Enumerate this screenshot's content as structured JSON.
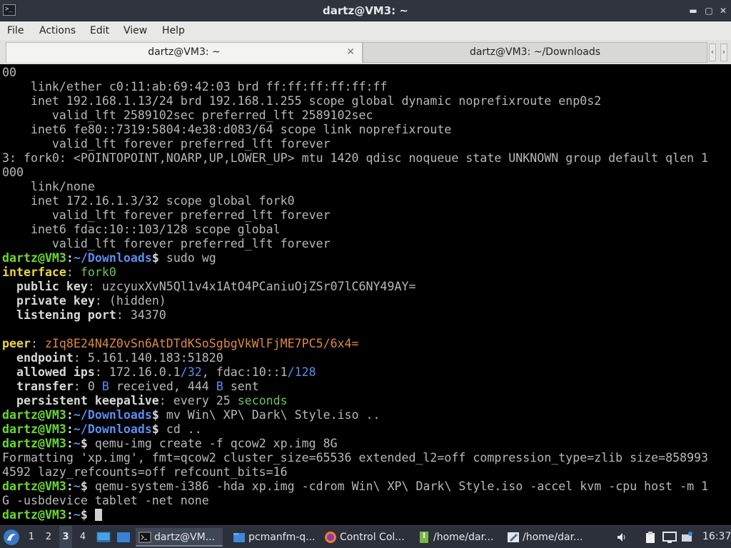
{
  "window": {
    "title": "dartz@VM3: ~"
  },
  "menubar": {
    "items": [
      "File",
      "Actions",
      "Edit",
      "View",
      "Help"
    ]
  },
  "tabs": [
    {
      "label": "dartz@VM3: ~",
      "active": true
    },
    {
      "label": "dartz@VM3: ~/Downloads",
      "active": false
    }
  ],
  "terminal": {
    "prompt_user": "dartz@VM3",
    "prompt_path_downloads": "~/Downloads",
    "prompt_path_home": "~",
    "lines": [
      "00",
      "    link/ether c0:11:ab:69:42:03 brd ff:ff:ff:ff:ff:ff",
      "    inet 192.168.1.13/24 brd 192.168.1.255 scope global dynamic noprefixroute enp0s2",
      "       valid_lft 2589102sec preferred_lft 2589102sec",
      "    inet6 fe80::7319:5804:4e38:d083/64 scope link noprefixroute",
      "       valid_lft forever preferred_lft forever",
      "3: fork0: <POINTOPOINT,NOARP,UP,LOWER_UP> mtu 1420 qdisc noqueue state UNKNOWN group default qlen 1",
      "000",
      "    link/none",
      "    inet 172.16.1.3/32 scope global fork0",
      "       valid_lft forever preferred_lft forever",
      "    inet6 fdac:10::103/128 scope global",
      "       valid_lft forever preferred_lft forever"
    ],
    "cmd_wg": "sudo wg",
    "wg": {
      "interface_label": "interface",
      "interface_name": "fork0",
      "public_key_label": "public key",
      "public_key": "uzcyuxXvN5Ql1v4x1AtO4PCaniuOjZSr07lC6NY49AY=",
      "private_key_label": "private key",
      "private_key": "(hidden)",
      "listening_port_label": "listening port",
      "listening_port": "34370",
      "peer_label": "peer",
      "peer_key": "zIq8E24N4Z0vSn6AtDTdKSoSgbgVkWlFjME7PC5/6x4=",
      "endpoint_label": "endpoint",
      "endpoint": "5.161.140.183:51820",
      "allowed_ips_label": "allowed ips",
      "allowed_ip_1": "172.16.0.1",
      "allowed_ip_1_mask": "/32",
      "allowed_ip_2": "fdac:10::1",
      "allowed_ip_2_mask": "/128",
      "transfer_label": "transfer",
      "transfer_rx_num": "0",
      "transfer_rx_unit": "B",
      "transfer_rx_word": "received",
      "transfer_tx_num": "444",
      "transfer_tx_unit": "B",
      "transfer_tx_word": "sent",
      "keepalive_label": "persistent keepalive",
      "keepalive_prefix": "every 25",
      "keepalive_unit": "seconds"
    },
    "cmd_mv": "mv Win\\ XP\\ Dark\\ Style.iso ..",
    "cmd_cd": "cd ..",
    "cmd_qemu_img": "qemu-img create -f qcow2 xp.img 8G",
    "output_format_1": "Formatting 'xp.img', fmt=qcow2 cluster_size=65536 extended_l2=off compression_type=zlib size=858993",
    "output_format_2": "4592 lazy_refcounts=off refcount_bits=16",
    "cmd_qemu_sys_1": "qemu-system-i386 -hda xp.img -cdrom Win\\ XP\\ Dark\\ Style.iso -accel kvm -cpu host -m 1",
    "cmd_qemu_sys_2": "G -usbdevice tablet -net none"
  },
  "taskbar": {
    "workspaces": [
      "1",
      "2",
      "3",
      "4"
    ],
    "current_workspace": "3",
    "tasks": [
      {
        "label": "dartz@VM...",
        "icon": "terminal-icon",
        "active": true
      },
      {
        "label": "pcmanfm-q...",
        "icon": "folder-icon",
        "active": false
      },
      {
        "label": "Control Col...",
        "icon": "firefox-icon",
        "active": false
      },
      {
        "label": "/home/dar...",
        "icon": "file-archive-icon",
        "active": false
      },
      {
        "label": "/home/dar...",
        "icon": "text-editor-icon",
        "active": false
      }
    ],
    "clock": "16:37"
  },
  "colors": {
    "prompt_green": "#6ada2b",
    "prompt_blue": "#5a8df0",
    "wg_yellow": "#e8d63c",
    "wg_orange": "#dd8a3e",
    "terminal_bg": "#000000",
    "panel_bg": "#2b303b"
  }
}
